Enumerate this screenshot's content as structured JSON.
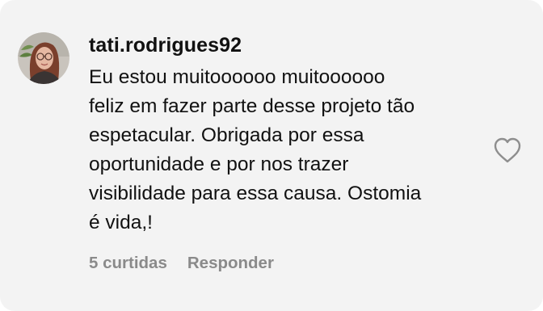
{
  "comment": {
    "username": "tati.rodrigues92",
    "text": "Eu estou muitoooooo muitoooooo\nfeliz em fazer parte desse projeto tão\nespetacular. Obrigada por essa\noportunidade e por nos trazer\nvisibilidade para essa causa. Ostomia\né vida,!",
    "likes_label": "5 curtidas",
    "reply_label": "Responder",
    "like_icon": "heart-outline-icon"
  },
  "colors": {
    "card_background": "#f3f3f3",
    "text": "#111111",
    "muted": "#8a8a8a"
  }
}
